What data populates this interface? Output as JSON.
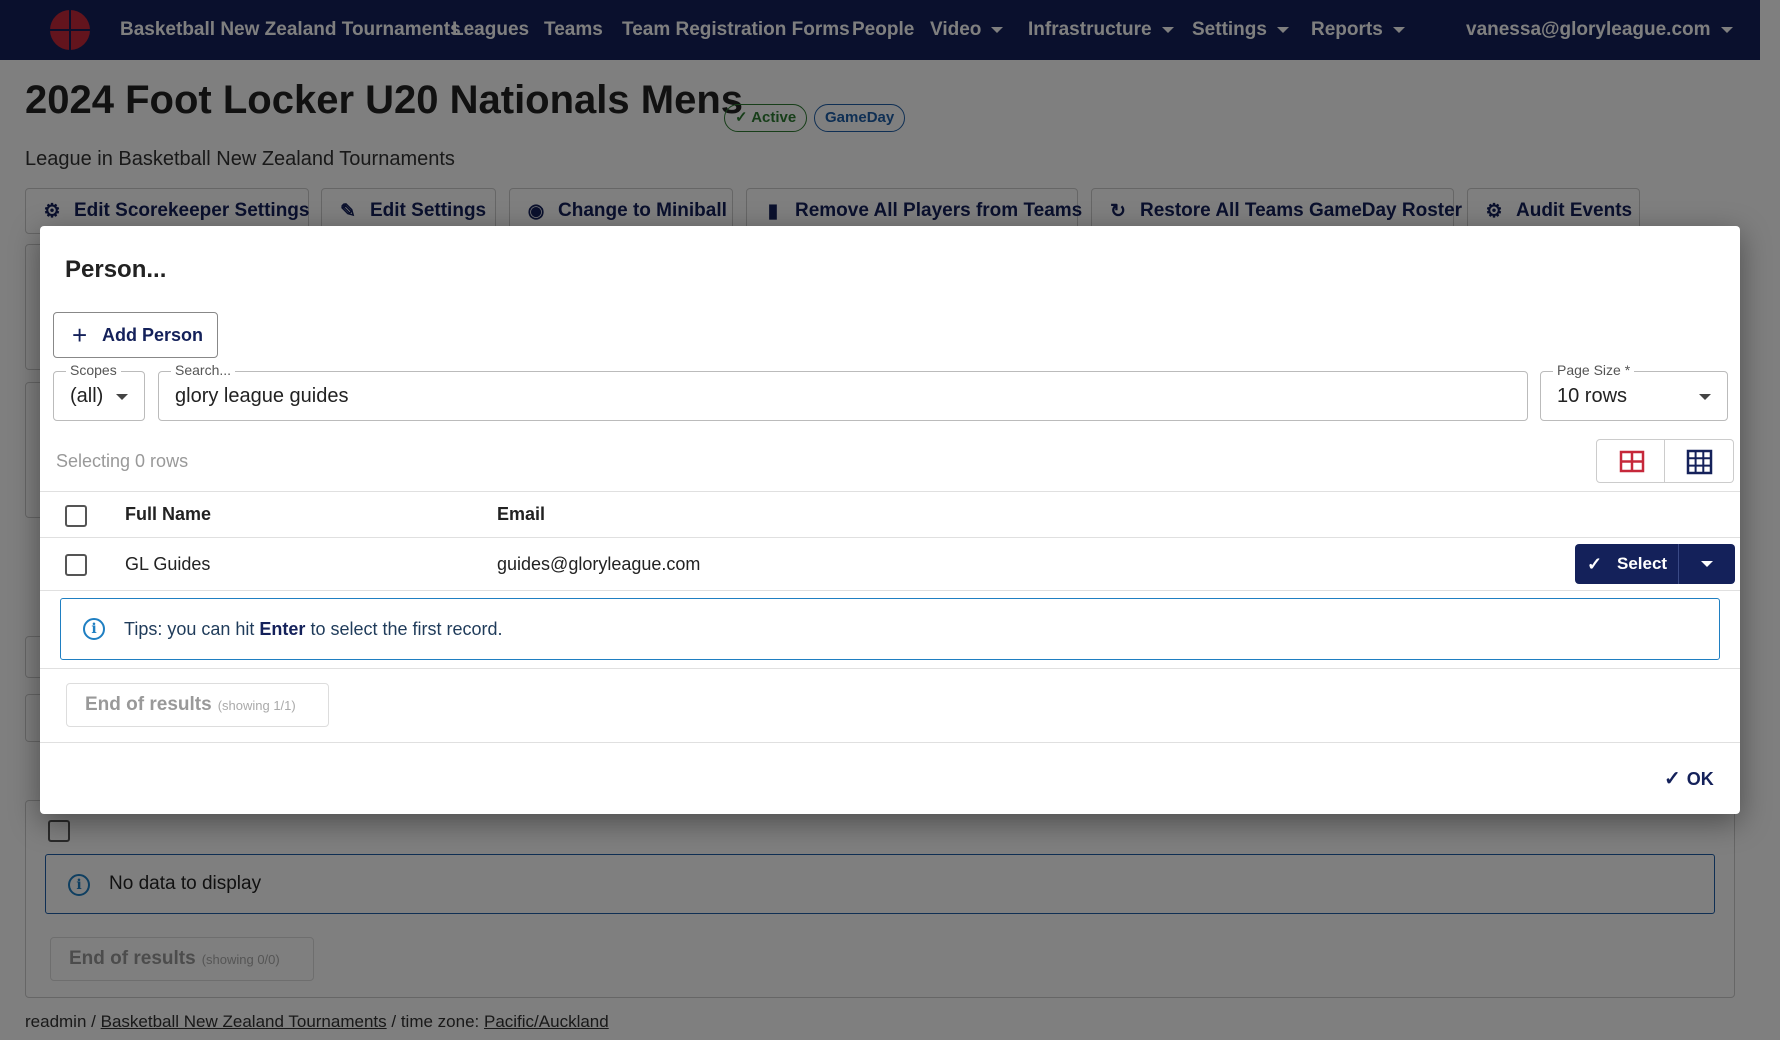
{
  "nav": {
    "brand": "Basketball New Zealand Tournaments",
    "items": [
      "Leagues",
      "Teams",
      "Team Registration Forms",
      "People",
      "Video",
      "Infrastructure",
      "Settings",
      "Reports"
    ],
    "user": "vanessa@gloryleague.com"
  },
  "page": {
    "title": "2024 Foot Locker U20 Nationals Mens",
    "badges": [
      "Active",
      "GameDay"
    ],
    "subtitle": "League in Basketball New Zealand Tournaments",
    "actions": [
      {
        "label": "Edit Scorekeeper Settings",
        "icon": "gear-icon"
      },
      {
        "label": "Edit Settings",
        "icon": "pencil-icon"
      },
      {
        "label": "Change to Miniball",
        "icon": "basketball-icon"
      },
      {
        "label": "Remove All Players from Teams",
        "icon": "trash-icon"
      },
      {
        "label": "Restore All Teams GameDay Roster",
        "icon": "refresh-icon"
      },
      {
        "label": "Audit Events",
        "icon": "gear-icon"
      }
    ],
    "no_data": "No data to display",
    "end_results": "End of results",
    "end_showing": "(showing 0/0)",
    "footer_user": "readmin",
    "footer_sep": "/",
    "footer_org": "Basketball New Zealand Tournaments",
    "footer_tz_label": "/ time zone:",
    "footer_tz": "Pacific/Auckland"
  },
  "modal": {
    "title": "Person...",
    "add_label": "Add Person",
    "scopes": {
      "label": "Scopes",
      "value": "(all)"
    },
    "search": {
      "label": "Search...",
      "value": "glory league guides"
    },
    "page_size": {
      "label": "Page Size *",
      "value": "10 rows"
    },
    "selecting": "Selecting 0 rows",
    "columns": {
      "name": "Full Name",
      "email": "Email"
    },
    "rows": [
      {
        "name": "GL Guides",
        "email": "guides@gloryleague.com"
      }
    ],
    "select_label": "Select",
    "tips_prefix": "Tips: you can hit",
    "tips_key": "Enter",
    "tips_suffix": "to select the first record.",
    "end_results": "End of results",
    "end_showing": "(showing 1/1)",
    "ok_label": "OK"
  },
  "colors": {
    "navy": "#14215a",
    "brand_red": "#c6283a",
    "active_green": "#2e7d32",
    "info_blue": "#1f7fc2"
  }
}
